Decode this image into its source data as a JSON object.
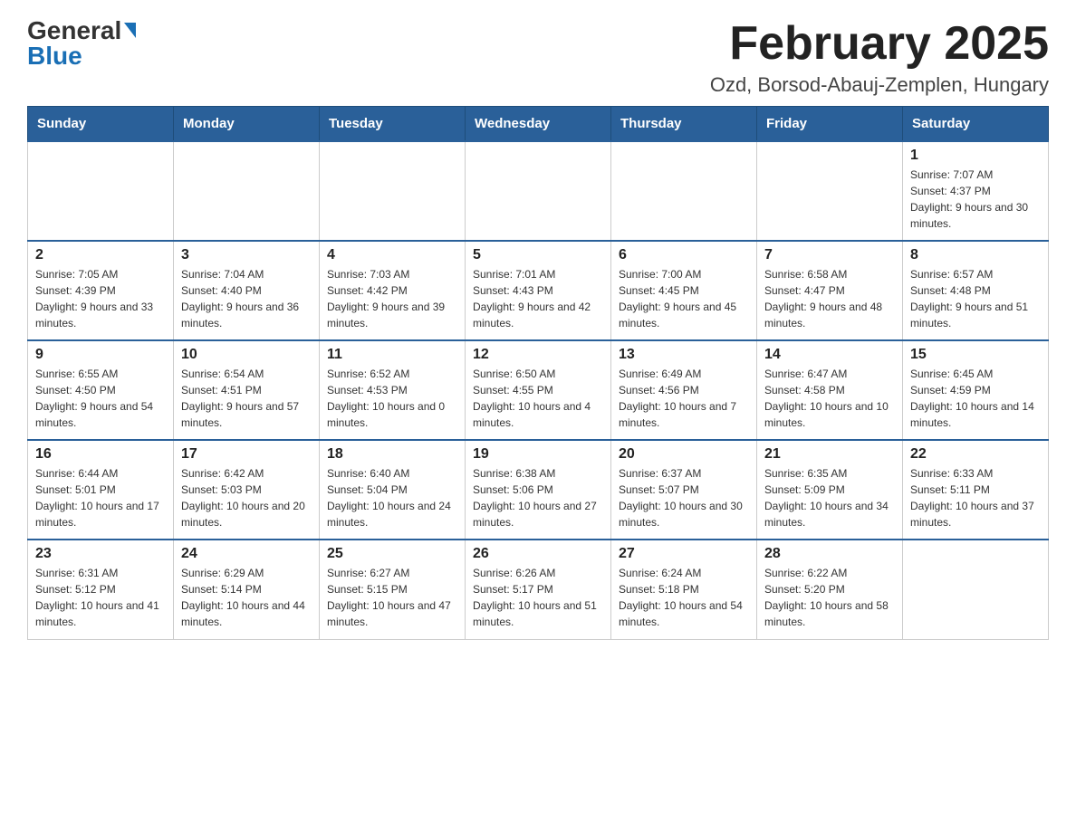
{
  "logo": {
    "text_general": "General",
    "text_blue": "Blue",
    "arrow": "▲"
  },
  "header": {
    "title": "February 2025",
    "location": "Ozd, Borsod-Abauj-Zemplen, Hungary"
  },
  "days_of_week": [
    "Sunday",
    "Monday",
    "Tuesday",
    "Wednesday",
    "Thursday",
    "Friday",
    "Saturday"
  ],
  "weeks": [
    [
      {
        "day": "",
        "info": ""
      },
      {
        "day": "",
        "info": ""
      },
      {
        "day": "",
        "info": ""
      },
      {
        "day": "",
        "info": ""
      },
      {
        "day": "",
        "info": ""
      },
      {
        "day": "",
        "info": ""
      },
      {
        "day": "1",
        "info": "Sunrise: 7:07 AM\nSunset: 4:37 PM\nDaylight: 9 hours and 30 minutes."
      }
    ],
    [
      {
        "day": "2",
        "info": "Sunrise: 7:05 AM\nSunset: 4:39 PM\nDaylight: 9 hours and 33 minutes."
      },
      {
        "day": "3",
        "info": "Sunrise: 7:04 AM\nSunset: 4:40 PM\nDaylight: 9 hours and 36 minutes."
      },
      {
        "day": "4",
        "info": "Sunrise: 7:03 AM\nSunset: 4:42 PM\nDaylight: 9 hours and 39 minutes."
      },
      {
        "day": "5",
        "info": "Sunrise: 7:01 AM\nSunset: 4:43 PM\nDaylight: 9 hours and 42 minutes."
      },
      {
        "day": "6",
        "info": "Sunrise: 7:00 AM\nSunset: 4:45 PM\nDaylight: 9 hours and 45 minutes."
      },
      {
        "day": "7",
        "info": "Sunrise: 6:58 AM\nSunset: 4:47 PM\nDaylight: 9 hours and 48 minutes."
      },
      {
        "day": "8",
        "info": "Sunrise: 6:57 AM\nSunset: 4:48 PM\nDaylight: 9 hours and 51 minutes."
      }
    ],
    [
      {
        "day": "9",
        "info": "Sunrise: 6:55 AM\nSunset: 4:50 PM\nDaylight: 9 hours and 54 minutes."
      },
      {
        "day": "10",
        "info": "Sunrise: 6:54 AM\nSunset: 4:51 PM\nDaylight: 9 hours and 57 minutes."
      },
      {
        "day": "11",
        "info": "Sunrise: 6:52 AM\nSunset: 4:53 PM\nDaylight: 10 hours and 0 minutes."
      },
      {
        "day": "12",
        "info": "Sunrise: 6:50 AM\nSunset: 4:55 PM\nDaylight: 10 hours and 4 minutes."
      },
      {
        "day": "13",
        "info": "Sunrise: 6:49 AM\nSunset: 4:56 PM\nDaylight: 10 hours and 7 minutes."
      },
      {
        "day": "14",
        "info": "Sunrise: 6:47 AM\nSunset: 4:58 PM\nDaylight: 10 hours and 10 minutes."
      },
      {
        "day": "15",
        "info": "Sunrise: 6:45 AM\nSunset: 4:59 PM\nDaylight: 10 hours and 14 minutes."
      }
    ],
    [
      {
        "day": "16",
        "info": "Sunrise: 6:44 AM\nSunset: 5:01 PM\nDaylight: 10 hours and 17 minutes."
      },
      {
        "day": "17",
        "info": "Sunrise: 6:42 AM\nSunset: 5:03 PM\nDaylight: 10 hours and 20 minutes."
      },
      {
        "day": "18",
        "info": "Sunrise: 6:40 AM\nSunset: 5:04 PM\nDaylight: 10 hours and 24 minutes."
      },
      {
        "day": "19",
        "info": "Sunrise: 6:38 AM\nSunset: 5:06 PM\nDaylight: 10 hours and 27 minutes."
      },
      {
        "day": "20",
        "info": "Sunrise: 6:37 AM\nSunset: 5:07 PM\nDaylight: 10 hours and 30 minutes."
      },
      {
        "day": "21",
        "info": "Sunrise: 6:35 AM\nSunset: 5:09 PM\nDaylight: 10 hours and 34 minutes."
      },
      {
        "day": "22",
        "info": "Sunrise: 6:33 AM\nSunset: 5:11 PM\nDaylight: 10 hours and 37 minutes."
      }
    ],
    [
      {
        "day": "23",
        "info": "Sunrise: 6:31 AM\nSunset: 5:12 PM\nDaylight: 10 hours and 41 minutes."
      },
      {
        "day": "24",
        "info": "Sunrise: 6:29 AM\nSunset: 5:14 PM\nDaylight: 10 hours and 44 minutes."
      },
      {
        "day": "25",
        "info": "Sunrise: 6:27 AM\nSunset: 5:15 PM\nDaylight: 10 hours and 47 minutes."
      },
      {
        "day": "26",
        "info": "Sunrise: 6:26 AM\nSunset: 5:17 PM\nDaylight: 10 hours and 51 minutes."
      },
      {
        "day": "27",
        "info": "Sunrise: 6:24 AM\nSunset: 5:18 PM\nDaylight: 10 hours and 54 minutes."
      },
      {
        "day": "28",
        "info": "Sunrise: 6:22 AM\nSunset: 5:20 PM\nDaylight: 10 hours and 58 minutes."
      },
      {
        "day": "",
        "info": ""
      }
    ]
  ]
}
